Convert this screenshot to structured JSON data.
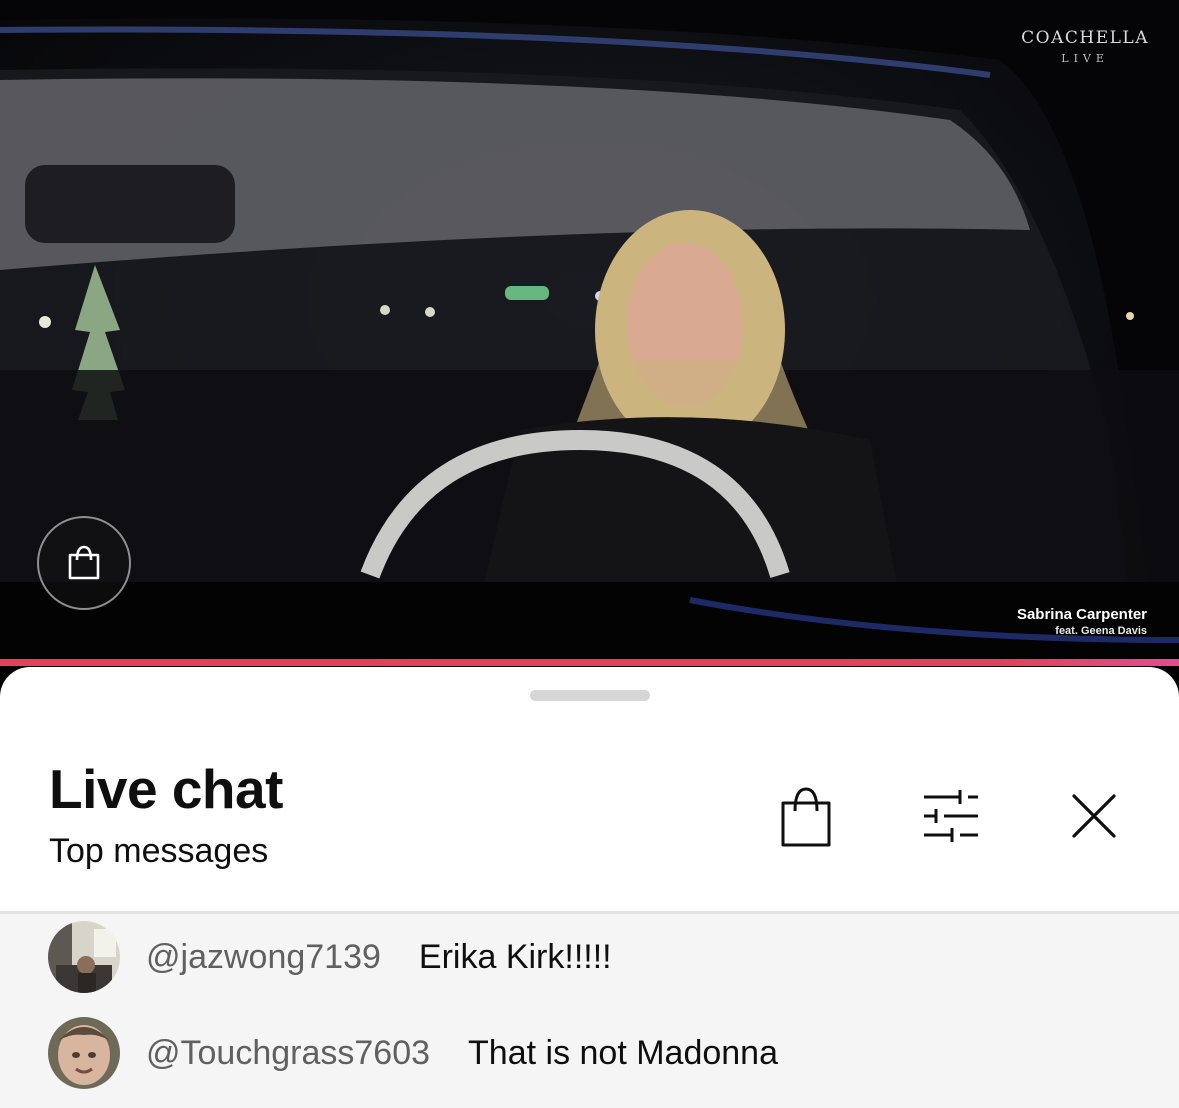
{
  "video": {
    "brand_name": "COACHELLA",
    "brand_sub": "LIVE",
    "caption_artist": "Sabrina Carpenter",
    "caption_feat": "feat. Geena Davis",
    "progress_fraction": 1.0
  },
  "chat": {
    "title": "Live chat",
    "subtitle": "Top messages",
    "icons": {
      "shopping": "shopping-bag-icon",
      "filter": "sliders-icon",
      "close": "close-icon"
    },
    "messages": [
      {
        "author": "@jazwong7139",
        "text": "Erika Kirk!!!!!"
      },
      {
        "author": "@Touchgrass7603",
        "text": "That is not Madonna"
      }
    ]
  },
  "colors": {
    "progress": "#e5405b",
    "sheet_bg": "#ffffff",
    "message_bg": "#f5f5f5",
    "author": "#606060"
  }
}
